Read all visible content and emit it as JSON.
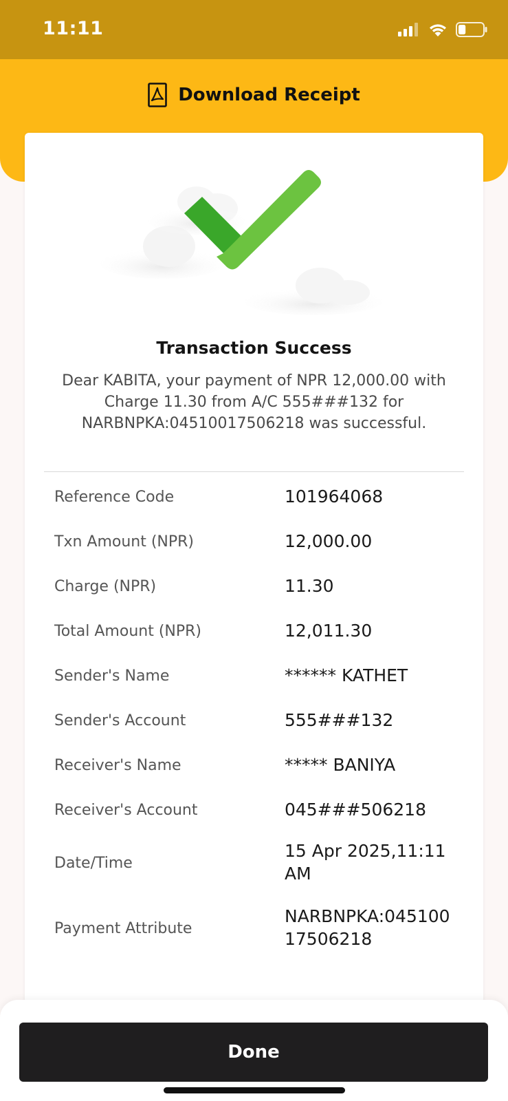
{
  "status_bar": {
    "time": "11:11",
    "icons": [
      "cellular-signal-icon",
      "wifi-icon",
      "battery-icon"
    ],
    "battery_level": 0.3
  },
  "header": {
    "download_label": "Download Receipt",
    "icon": "pdf-file-icon"
  },
  "receipt": {
    "status_icon": "checkmark-icon",
    "title": "Transaction Success",
    "message": "Dear KABITA, your payment of NPR 12,000.00 with Charge 11.30 from A/C 555###132 for NARBNPKA:04510017506218 was successful.",
    "rows": [
      {
        "label": "Reference Code",
        "value": "101964068"
      },
      {
        "label": "Txn Amount (NPR)",
        "value": "12,000.00"
      },
      {
        "label": "Charge (NPR)",
        "value": "11.30"
      },
      {
        "label": "Total Amount (NPR)",
        "value": "12,011.30"
      },
      {
        "label": "Sender's Name",
        "value": "****** KATHET"
      },
      {
        "label": "Sender's Account",
        "value": "555###132"
      },
      {
        "label": "Receiver's Name",
        "value": "***** BANIYA"
      },
      {
        "label": "Receiver's Account",
        "value": "045###506218"
      },
      {
        "label": "Date/Time",
        "value": "15 Apr 2025,11:11 AM"
      },
      {
        "label": "Payment Attribute",
        "value": "NARBNPKA:04510017506218"
      }
    ]
  },
  "footer": {
    "done_label": "Done"
  },
  "colors": {
    "status_bar": "#c79411",
    "header": "#fdb815",
    "check_dark": "#3aa72a",
    "check_light": "#6cc340",
    "button": "#1f1e1f"
  }
}
